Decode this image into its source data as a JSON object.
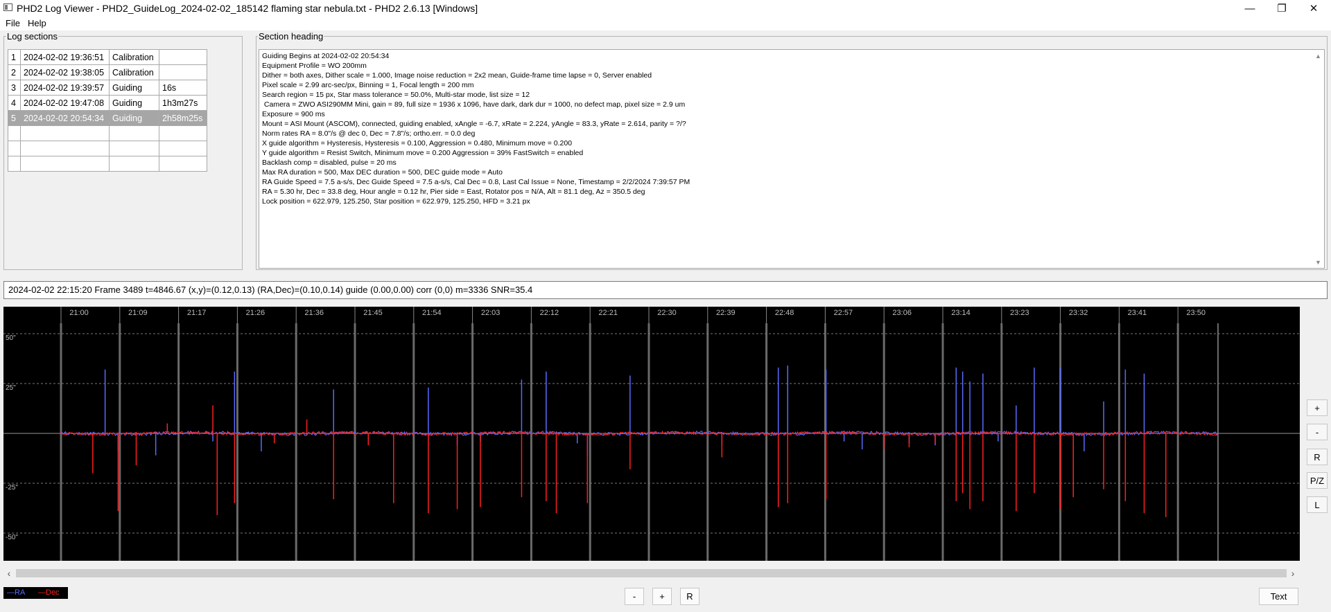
{
  "window": {
    "title": "PHD2 Log Viewer - PHD2_GuideLog_2024-02-02_185142 flaming star nebula.txt - PHD2 2.6.13 [Windows]",
    "minimize_glyph": "—",
    "restore_glyph": "❐",
    "close_glyph": "✕"
  },
  "menu": {
    "file": "File",
    "help": "Help"
  },
  "log_sections": {
    "label": "Log sections",
    "rows": [
      {
        "num": "1",
        "time": "2024-02-02 19:36:51",
        "type": "Calibration",
        "duration": ""
      },
      {
        "num": "2",
        "time": "2024-02-02 19:38:05",
        "type": "Calibration",
        "duration": ""
      },
      {
        "num": "3",
        "time": "2024-02-02 19:39:57",
        "type": "Guiding",
        "duration": "16s"
      },
      {
        "num": "4",
        "time": "2024-02-02 19:47:08",
        "type": "Guiding",
        "duration": "1h3m27s"
      },
      {
        "num": "5",
        "time": "2024-02-02 20:54:34",
        "type": "Guiding",
        "duration": "2h58m25s"
      },
      {
        "num": "",
        "time": "",
        "type": "",
        "duration": ""
      },
      {
        "num": "",
        "time": "",
        "type": "",
        "duration": ""
      },
      {
        "num": "",
        "time": "",
        "type": "",
        "duration": ""
      }
    ],
    "selected_row": 5
  },
  "section_heading": {
    "label": "Section heading",
    "lines": [
      "Guiding Begins at 2024-02-02 20:54:34",
      "Equipment Profile = WO 200mm",
      "Dither = both axes, Dither scale = 1.000, Image noise reduction = 2x2 mean, Guide-frame time lapse = 0, Server enabled",
      "Pixel scale = 2.99 arc-sec/px, Binning = 1, Focal length = 200 mm",
      "Search region = 15 px, Star mass tolerance = 50.0%, Multi-star mode, list size = 12",
      " Camera = ZWO ASI290MM Mini, gain = 89, full size = 1936 x 1096, have dark, dark dur = 1000, no defect map, pixel size = 2.9 um",
      "Exposure = 900 ms",
      "Mount = ASI Mount (ASCOM), connected, guiding enabled, xAngle = -6.7, xRate = 2.224, yAngle = 83.3, yRate = 2.614, parity = ?/?",
      "Norm rates RA = 8.0\"/s @ dec 0, Dec = 7.8\"/s; ortho.err. = 0.0 deg",
      "X guide algorithm = Hysteresis, Hysteresis = 0.100, Aggression = 0.480, Minimum move = 0.200",
      "Y guide algorithm = Resist Switch, Minimum move = 0.200 Aggression = 39% FastSwitch = enabled",
      "Backlash comp = disabled, pulse = 20 ms",
      "Max RA duration = 500, Max DEC duration = 500, DEC guide mode = Auto",
      "RA Guide Speed = 7.5 a-s/s, Dec Guide Speed = 7.5 a-s/s, Cal Dec = 0.8, Last Cal Issue = None, Timestamp = 2/2/2024 7:39:57 PM",
      "RA = 5.30 hr, Dec = 33.8 deg, Hour angle = 0.12 hr, Pier side = East, Rotator pos = N/A, Alt = 81.1 deg, Az = 350.5 deg",
      "Lock position = 622.979, 125.250, Star position = 622.979, 125.250, HFD = 3.21 px"
    ]
  },
  "status": "2024-02-02 22:15:20 Frame 3489 t=4846.67 (x,y)=(0.12,0.13) (RA,Dec)=(0.10,0.14) guide (0.00,0.00) corr (0,0) m=3336 SNR=35.4",
  "chart_data": {
    "type": "line",
    "x_tick_labels": [
      "21:00",
      "21:09",
      "21:17",
      "21:26",
      "21:36",
      "21:45",
      "21:54",
      "22:03",
      "22:12",
      "22:21",
      "22:30",
      "22:39",
      "22:48",
      "22:57",
      "23:06",
      "23:14",
      "23:23",
      "23:32",
      "23:41",
      "23:50"
    ],
    "y_tick_labels": [
      "50\"",
      "25\"",
      "-25\"",
      "-50\""
    ],
    "ylim": [
      -60,
      60
    ],
    "grid": true,
    "series": [
      {
        "name": "RA",
        "color": "#5a6bff",
        "spikes": [
          [
            0.061,
            32
          ],
          [
            0.079,
            -9
          ],
          [
            0.131,
            -11
          ],
          [
            0.21,
            -4
          ],
          [
            0.24,
            31
          ],
          [
            0.277,
            -9
          ],
          [
            0.377,
            22
          ],
          [
            0.425,
            -4
          ],
          [
            0.508,
            23
          ],
          [
            0.548,
            -6
          ],
          [
            0.58,
            -4
          ],
          [
            0.637,
            27
          ],
          [
            0.671,
            31
          ],
          [
            0.714,
            -5
          ],
          [
            0.728,
            -11
          ],
          [
            0.787,
            29
          ],
          [
            0.914,
            -6
          ],
          [
            0.992,
            33
          ],
          [
            1.005,
            34
          ],
          [
            1.058,
            32
          ],
          [
            1.083,
            -4
          ],
          [
            1.108,
            -8
          ],
          [
            1.173,
            -5
          ],
          [
            1.209,
            -6
          ],
          [
            1.238,
            33
          ],
          [
            1.247,
            31
          ],
          [
            1.257,
            26
          ],
          [
            1.275,
            30
          ],
          [
            1.296,
            -4
          ],
          [
            1.321,
            14
          ],
          [
            1.346,
            33
          ],
          [
            1.382,
            33
          ],
          [
            1.4,
            -4
          ],
          [
            1.415,
            -9
          ],
          [
            1.442,
            16
          ],
          [
            1.472,
            32
          ],
          [
            1.498,
            30
          ],
          [
            1.528,
            -9
          ]
        ]
      },
      {
        "name": "Dec",
        "color": "#ff2020",
        "spikes": [
          [
            0.044,
            -20
          ],
          [
            0.079,
            -39
          ],
          [
            0.104,
            -16
          ],
          [
            0.147,
            5
          ],
          [
            0.21,
            14
          ],
          [
            0.216,
            -41
          ],
          [
            0.24,
            -35
          ],
          [
            0.295,
            -5
          ],
          [
            0.34,
            7
          ],
          [
            0.377,
            -33
          ],
          [
            0.425,
            -6
          ],
          [
            0.46,
            -35
          ],
          [
            0.508,
            -40
          ],
          [
            0.548,
            -38
          ],
          [
            0.58,
            -37
          ],
          [
            0.637,
            -32
          ],
          [
            0.671,
            -34
          ],
          [
            0.685,
            -40
          ],
          [
            0.728,
            -35
          ],
          [
            0.787,
            -18
          ],
          [
            0.914,
            -12
          ],
          [
            0.992,
            -37
          ],
          [
            1.005,
            -35
          ],
          [
            1.058,
            -33
          ],
          [
            1.138,
            -8
          ],
          [
            1.173,
            -7
          ],
          [
            1.209,
            -5
          ],
          [
            1.238,
            -34
          ],
          [
            1.247,
            -30
          ],
          [
            1.257,
            -38
          ],
          [
            1.275,
            -34
          ],
          [
            1.321,
            -39
          ],
          [
            1.346,
            -30
          ],
          [
            1.382,
            -38
          ],
          [
            1.4,
            -32
          ],
          [
            1.442,
            -28
          ],
          [
            1.472,
            -34
          ],
          [
            1.498,
            -40
          ],
          [
            1.528,
            -42
          ]
        ]
      }
    ]
  },
  "side_buttons": [
    "+",
    "-",
    "R",
    "P/Z",
    "L"
  ],
  "legend": {
    "ra": "—RA",
    "dec": "—Dec"
  },
  "bottom_buttons": {
    "minus": "-",
    "plus": "+",
    "reset": "R",
    "text": "Text"
  },
  "scroll": {
    "left": "‹",
    "right": "›",
    "up": "▲",
    "down": "▼"
  }
}
